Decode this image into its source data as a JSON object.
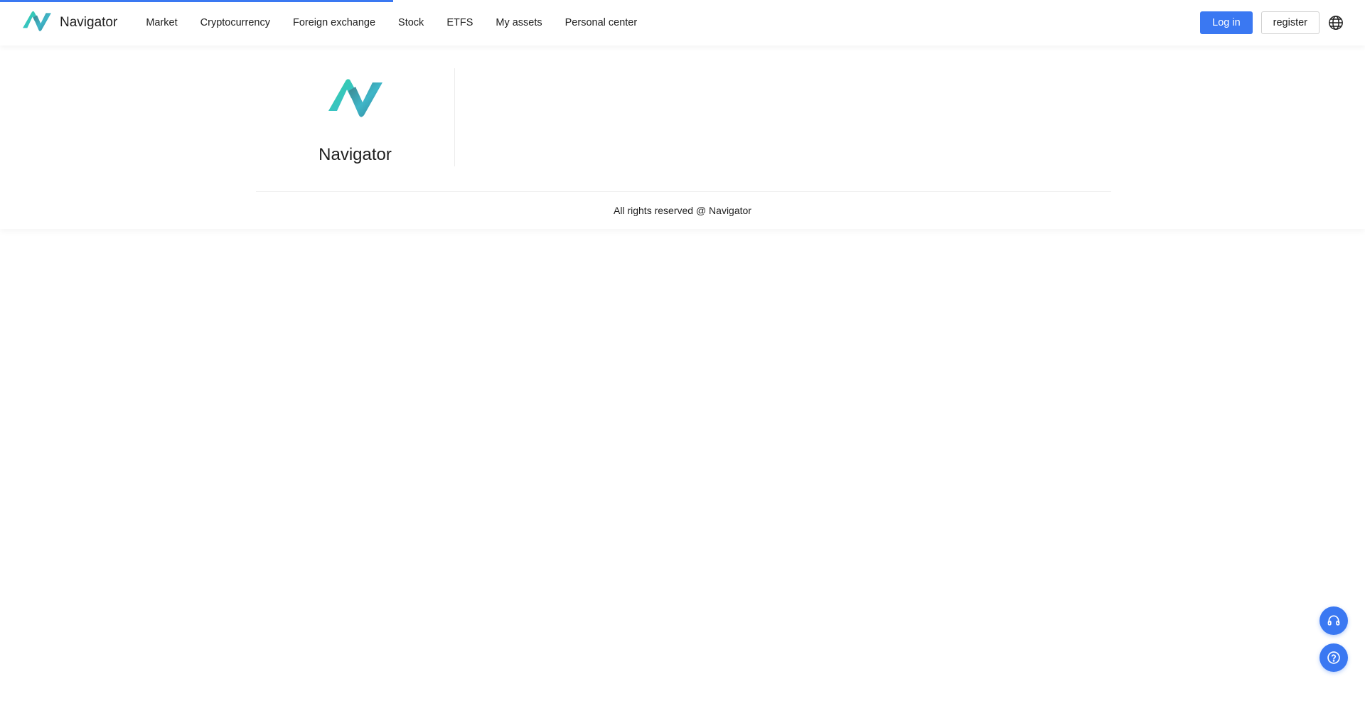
{
  "header": {
    "brand_name": "Navigator",
    "nav": [
      {
        "label": "Market"
      },
      {
        "label": "Cryptocurrency"
      },
      {
        "label": "Foreign exchange"
      },
      {
        "label": "Stock"
      },
      {
        "label": "ETFS"
      },
      {
        "label": "My assets"
      },
      {
        "label": "Personal center"
      }
    ],
    "login_label": "Log in",
    "register_label": "register",
    "language_icon": "globe-icon"
  },
  "footer": {
    "brand_name": "Navigator",
    "copyright": "All rights reserved @ Navigator"
  },
  "floating": {
    "support_icon": "headset-icon",
    "help_icon": "question-icon"
  },
  "colors": {
    "accent": "#3a78f2",
    "logo_gradient_start": "#3fd6a8",
    "logo_gradient_end": "#3aa3d9"
  }
}
